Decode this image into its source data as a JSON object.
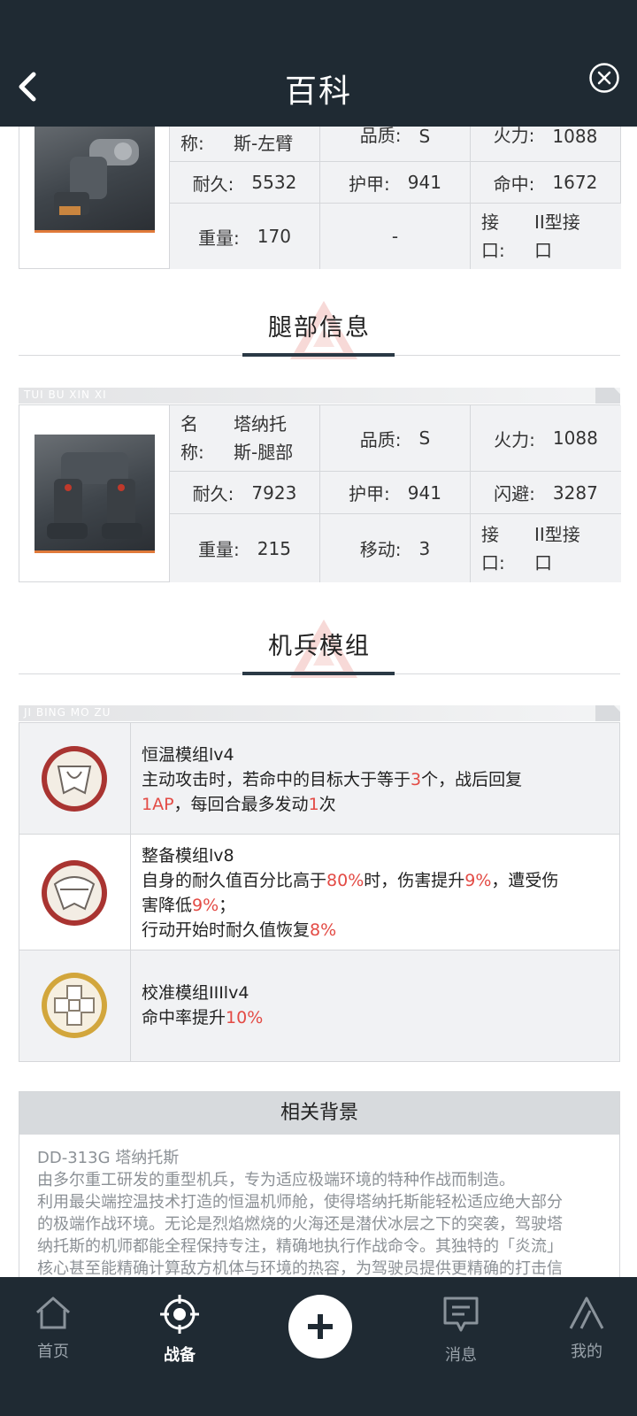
{
  "header": {
    "title": "百科"
  },
  "arm": {
    "name_label_tail": "称:",
    "name_value_tail": "斯-左臂",
    "quality_label": "品质:",
    "quality_value": "S",
    "fire_label": "火力:",
    "fire_value": "1088",
    "durability_label": "耐久:",
    "durability_value": "5532",
    "armor_label": "护甲:",
    "armor_value": "941",
    "hit_label": "命中:",
    "hit_value": "1672",
    "weight_label": "重量:",
    "weight_value": "170",
    "empty_value": "-",
    "interface_label_1": "接",
    "interface_label_2": "口:",
    "interface_value_1": "II型接",
    "interface_value_2": "口"
  },
  "legs_section": {
    "title": "腿部信息",
    "ribbon": "TUI BU XIN XI"
  },
  "legs": {
    "name_label_1": "名",
    "name_label_2": "称:",
    "name_value_1": "塔纳托",
    "name_value_2": "斯-腿部",
    "quality_label": "品质:",
    "quality_value": "S",
    "fire_label": "火力:",
    "fire_value": "1088",
    "durability_label": "耐久:",
    "durability_value": "7923",
    "armor_label": "护甲:",
    "armor_value": "941",
    "evasion_label": "闪避:",
    "evasion_value": "3287",
    "weight_label": "重量:",
    "weight_value": "215",
    "move_label": "移动:",
    "move_value": "3",
    "interface_label_1": "接",
    "interface_label_2": "口:",
    "interface_value_1": "II型接",
    "interface_value_2": "口"
  },
  "modules_section": {
    "title": "机兵模组",
    "ribbon": "JI BING MO ZU"
  },
  "modules": [
    {
      "name": "恒温模组lv4",
      "icon": "thermostat-module-icon",
      "l1a": "主动攻击时，若命中的目标大于等于",
      "l1b": "3",
      "l1c": "个，战后回复",
      "l2a": "1AP",
      "l2b": "，每回合最多发动",
      "l2c": "1",
      "l2d": "次"
    },
    {
      "name": "整备模组lv8",
      "icon": "maintenance-module-icon",
      "l1a": "自身的耐久值百分比高于",
      "l1b": "80%",
      "l1c": "时，伤害提升",
      "l1d": "9%",
      "l1e": "，遭受伤",
      "l2a": "害降低",
      "l2b": "9%",
      "l2c": "；",
      "l3a": "行动开始时耐久值恢复",
      "l3b": "8%"
    },
    {
      "name": "校准模组IIIlv4",
      "icon": "calibration-module-icon",
      "l1a": "命中率提升",
      "l1b": "10%"
    }
  ],
  "background": {
    "title": "相关背景",
    "lines": [
      "DD-313G 塔纳托斯",
      "由多尔重工研发的重型机兵，专为适应极端环境的特种作战而制造。",
      "利用最尖端控温技术打造的恒温机师舱，使得塔纳托斯能轻松适应绝大部分",
      "的极端作战环境。无论是烈焰燃烧的火海还是潜伏冰层之下的突袭，驾驶塔",
      "纳托斯的机师都能全程保持专注，精确地执行作战命令。其独特的「炎流」",
      "核心甚至能精确计算敌方机体与环境的热容，为驾驶员提供更精确的打击信"
    ]
  },
  "nav": {
    "home": "首页",
    "battle": "战备",
    "messages": "消息",
    "mine": "我的"
  },
  "colors": {
    "dark": "#1f2a33",
    "highlight": "#e34b45",
    "accent_orange": "#e07a3a"
  }
}
